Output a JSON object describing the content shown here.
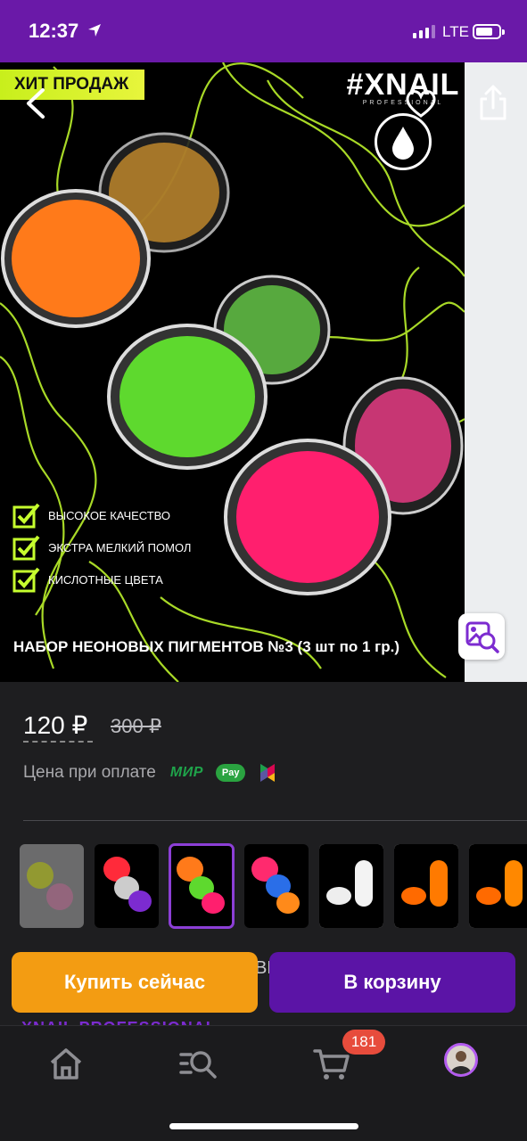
{
  "status_bar": {
    "time": "12:37",
    "carrier": "LTE"
  },
  "hero": {
    "badge": "ХИТ ПРОДАЖ",
    "brand_name": "#XNAIL",
    "brand_sub": "PROFESSIONAL",
    "features": [
      "ВЫСОКОЕ КАЧЕСТВО",
      "ЭКСТРА МЕЛКИЙ ПОМОЛ",
      "КИСЛОТНЫЕ ЦВЕТА"
    ],
    "title": "НАБОР НЕОНОВЫХ ПИГМЕНТОВ №3 (3 шт по 1 гр.)",
    "pigment_colors": [
      "#ff7a1a",
      "#5ed92e",
      "#ff1f6e"
    ],
    "accent_line_color": "#c6ff2e"
  },
  "price": {
    "current": "120 ₽",
    "old": "300 ₽",
    "pay_label": "Цена при оплате",
    "pay_methods": [
      "МИР",
      "Pay"
    ]
  },
  "thumbnails": [
    {
      "style": "faded",
      "selected": false
    },
    {
      "style": "dark",
      "selected": false
    },
    {
      "style": "dark",
      "selected": true
    },
    {
      "style": "dark",
      "selected": false
    },
    {
      "style": "white",
      "selected": false
    },
    {
      "style": "white",
      "selected": false
    },
    {
      "style": "white",
      "selected": false
    }
  ],
  "peek": {
    "fragment": "ВЬ",
    "brand_line": "XNAIL PROFESSIONAL"
  },
  "actions": {
    "buy_now": "Купить сейчас",
    "add_to_cart": "В корзину"
  },
  "bottom_nav": {
    "items": [
      "home-icon",
      "catalog-search-icon",
      "cart-icon",
      "profile-avatar"
    ],
    "cart_count": "181"
  },
  "colors": {
    "status_bar": "#6a19a8",
    "buy_now": "#f39c12",
    "add_to_cart": "#5b14a6",
    "badge": "#d6f22a"
  }
}
